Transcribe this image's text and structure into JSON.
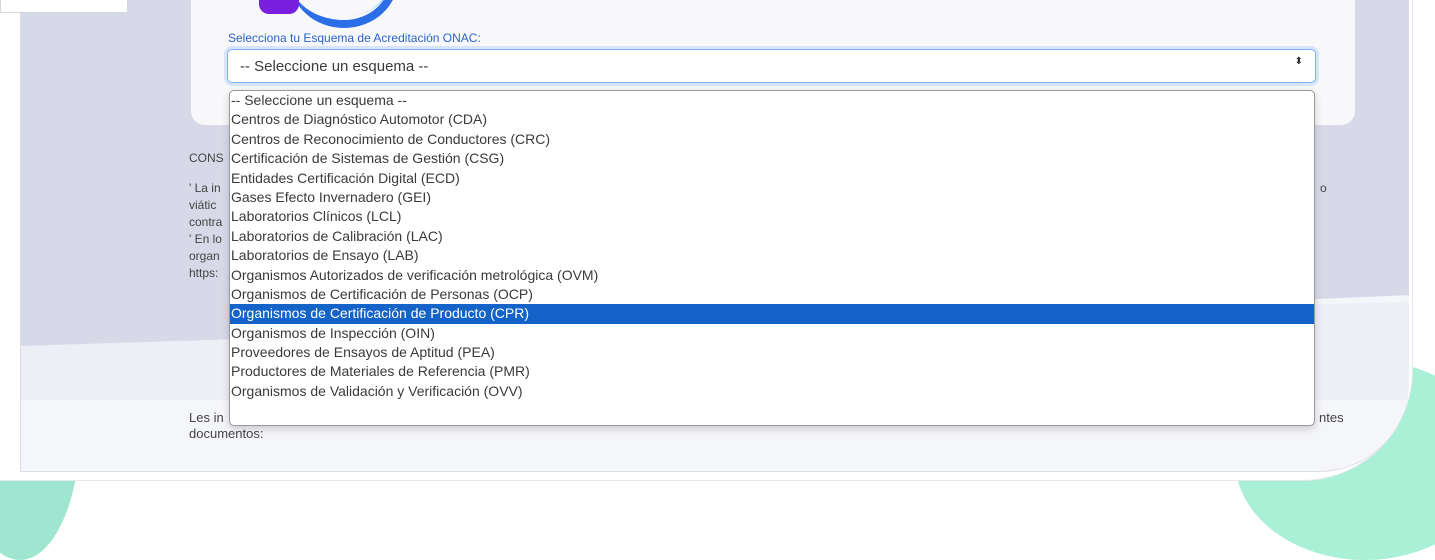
{
  "form": {
    "scheme_label": "Selecciona tu Esquema de Acreditación ONAC:",
    "select_value": "-- Seleccione un esquema --",
    "select_arrows": "⬍"
  },
  "dropdown": {
    "options": [
      "-- Seleccione un esquema --",
      "Centros de Diagnóstico Automotor (CDA)",
      "Centros de Reconocimiento de Conductores (CRC)",
      "Certificación de Sistemas de Gestión (CSG)",
      "Entidades Certificación Digital (ECD)",
      "Gases Efecto Invernadero (GEI)",
      "Laboratorios Clínicos (LCL)",
      "Laboratorios de Calibración (LAC)",
      "Laboratorios de Ensayo (LAB)",
      "Organismos Autorizados de verificación metrológica (OVM)",
      "Organismos de Certificación de Personas (OCP)",
      "Organismos de Certificación de Producto (CPR)",
      "Organismos de Inspección (OIN)",
      "Proveedores de Ensayos de Aptitud (PEA)",
      "Productores de Materiales de Referencia (PMR)",
      "Organismos de Validación y Verificación (OVV)"
    ],
    "selected_index": 11,
    "highlight_color": "#1463c9"
  },
  "background_text": {
    "cons": "CONS",
    "la_in": "' La in",
    "viatic": "viátic",
    "contra": "contra",
    "en_lo": "' En lo",
    "organ": "organ",
    "https": "https:",
    "right_o": "o",
    "les_in": "Les in",
    "ntes": "ntes",
    "documentos": "documentos:"
  }
}
